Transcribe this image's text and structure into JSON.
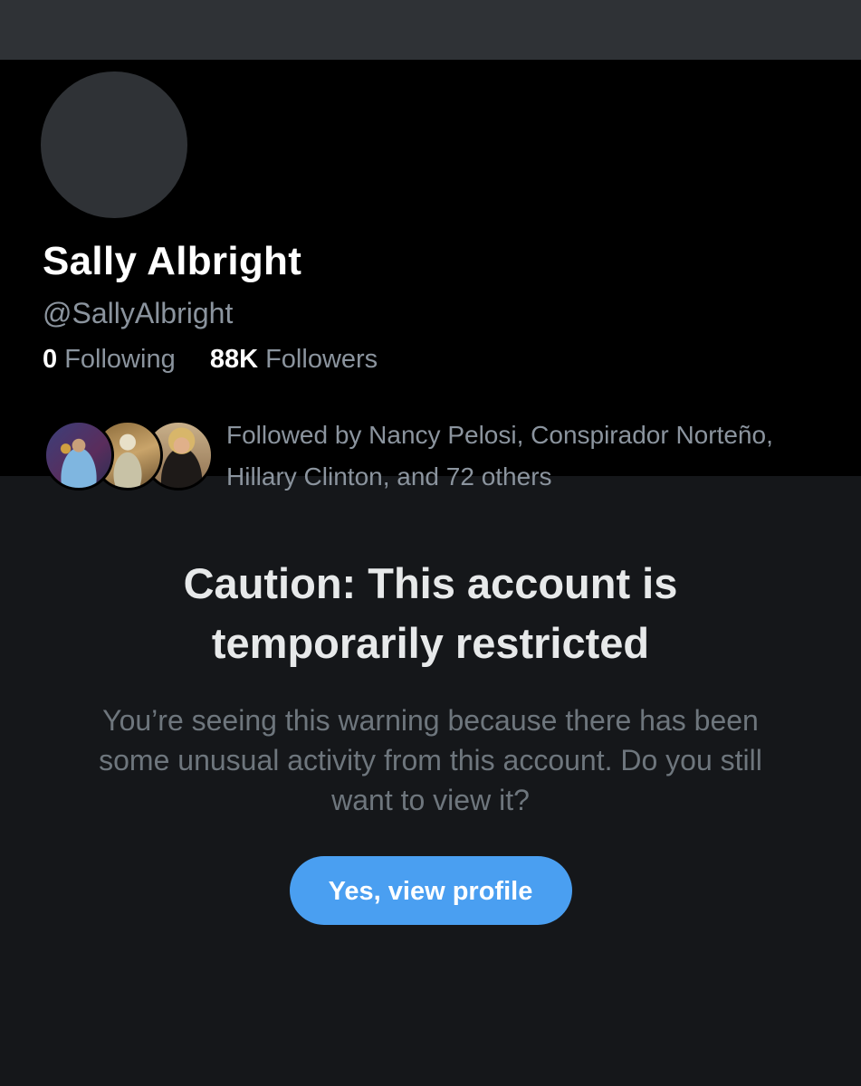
{
  "profile": {
    "display_name": "Sally Albright",
    "handle": "@SallyAlbright",
    "following_count": "0",
    "following_label": "Following",
    "followers_count": "88K",
    "followers_label": "Followers",
    "followed_by_text": "Followed by Nancy Pelosi, Conspirador Norteño, Hillary Clinton, and 72 others"
  },
  "warning": {
    "title": "Caution: This account is temporarily restricted",
    "body": "You’re seeing this warning because there has been some unusual activity from this account. Do you still want to view it?",
    "button_label": "Yes, view profile"
  },
  "colors": {
    "background": "#15171a",
    "header_background": "#000000",
    "banner": "#2f3236",
    "accent": "#4a9ff1",
    "secondary_text": "#8b949e"
  }
}
